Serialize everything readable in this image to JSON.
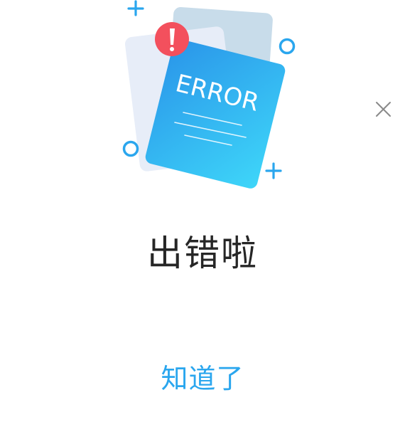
{
  "illustration": {
    "label": "ERROR",
    "icons": [
      "plus-icon",
      "ring-icon",
      "exclamation-icon",
      "document-icon"
    ],
    "colors": {
      "doc_gradient_start": "#2b98ea",
      "doc_gradient_end": "#3bd3f8",
      "back_doc": "#c7dcea",
      "middle_doc": "#e6ecf7",
      "alert": "#f3505d",
      "accent": "#2aa6ee"
    }
  },
  "dialog": {
    "title": "出错啦",
    "confirm_label": "知道了",
    "close_icon": "close-icon"
  }
}
